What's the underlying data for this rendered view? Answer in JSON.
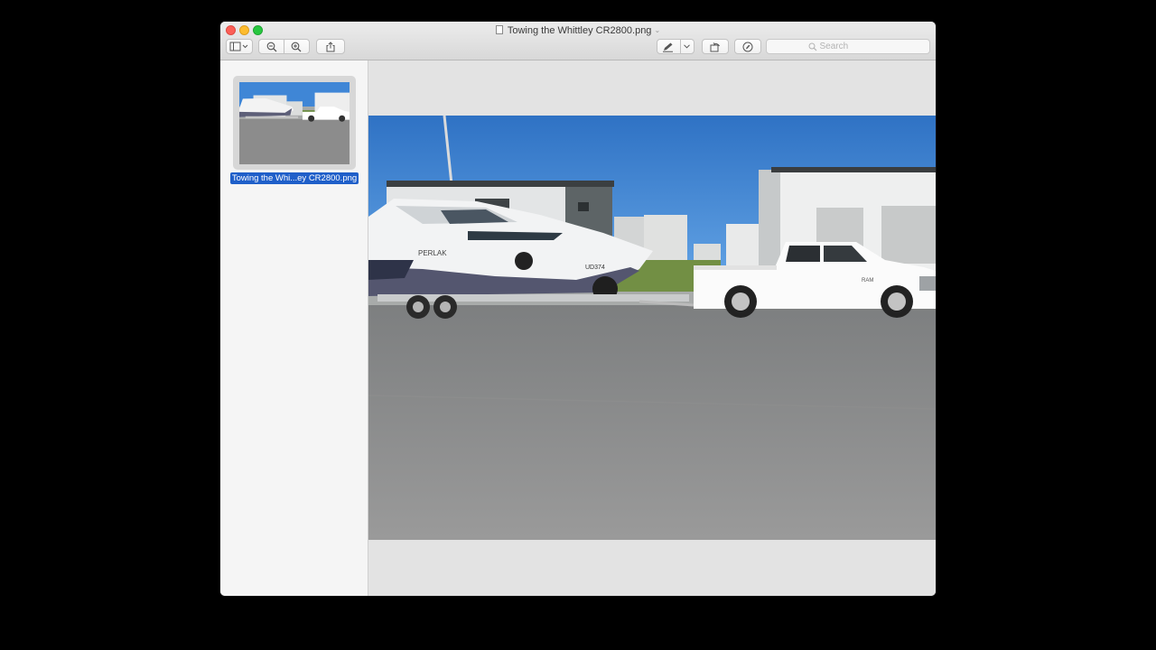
{
  "window": {
    "title": "Towing the Whittley CR2800.png",
    "title_icon": "document-icon",
    "title_menu_icon": "chevron-down-icon"
  },
  "toolbar": {
    "buttons": [
      {
        "name": "sidebar-toggle-button",
        "icon": "sidebar-icon"
      },
      {
        "name": "zoom-out-button",
        "icon": "zoom-out-icon"
      },
      {
        "name": "zoom-in-button",
        "icon": "zoom-in-icon"
      },
      {
        "name": "share-button",
        "icon": "share-icon"
      },
      {
        "name": "markup-button",
        "icon": "pen-icon"
      },
      {
        "name": "rotate-button",
        "icon": "rotate-icon"
      },
      {
        "name": "markup-toolbar-button",
        "icon": "markup-circle-icon"
      }
    ],
    "search": {
      "placeholder": "Search",
      "value": ""
    }
  },
  "sidebar": {
    "items": [
      {
        "label": "Towing the Whi...ey CR2800.png",
        "selected": true
      }
    ]
  },
  "image": {
    "boat_text": "PERLAK",
    "boat_reg": "UD374",
    "truck_badge": "RAM"
  },
  "colors": {
    "sky": "#3f86d6",
    "road": "#8a8a8a",
    "selection": "#1f5fc9"
  }
}
